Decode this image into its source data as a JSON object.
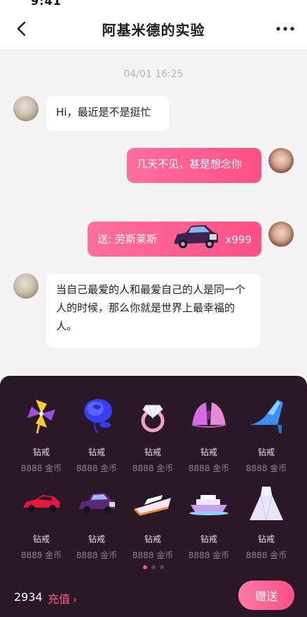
{
  "status_bar": {
    "time": "9:41"
  },
  "header": {
    "title": "阿基米德的实验"
  },
  "chat": {
    "timestamp": "04/01  16:25",
    "messages": [
      {
        "from": "other",
        "text": "Hi，最近是不是挺忙"
      },
      {
        "from": "me",
        "text": "几天不见，甚是想念你"
      },
      {
        "from": "me",
        "type": "gift",
        "label": "送: 劳斯莱斯",
        "count": "x999"
      },
      {
        "from": "other",
        "text": "当自己最爱的人和最爱自己的人是同一个人的时候，那么你就是世界上最幸福的人。"
      }
    ]
  },
  "gift_panel": {
    "gifts": [
      {
        "icon": "pinwheel-icon",
        "name": "钻戒",
        "price": "8888 金币"
      },
      {
        "icon": "blue-rose-icon",
        "name": "钻戒",
        "price": "8888 金币"
      },
      {
        "icon": "diamond-ring-icon",
        "name": "钻戒",
        "price": "8888 金币"
      },
      {
        "icon": "bra-icon",
        "name": "钻戒",
        "price": "8888 金币"
      },
      {
        "icon": "high-heel-icon",
        "name": "钻戒",
        "price": "8888 金币"
      },
      {
        "icon": "sports-car-icon",
        "name": "钻戒",
        "price": "8888 金币"
      },
      {
        "icon": "luxury-car-icon",
        "name": "钻戒",
        "price": "8888 金币"
      },
      {
        "icon": "yacht-icon",
        "name": "钻戒",
        "price": "8888 金币"
      },
      {
        "icon": "cruise-ship-icon",
        "name": "钻戒",
        "price": "8888 金币"
      },
      {
        "icon": "wedding-dress-icon",
        "name": "钻戒",
        "price": "8888 金币"
      }
    ],
    "balance": "2934",
    "recharge_label": "充值",
    "send_label": "赠送"
  },
  "colors": {
    "accent": "#ff4f86",
    "panel_bg": "#2a1826"
  }
}
